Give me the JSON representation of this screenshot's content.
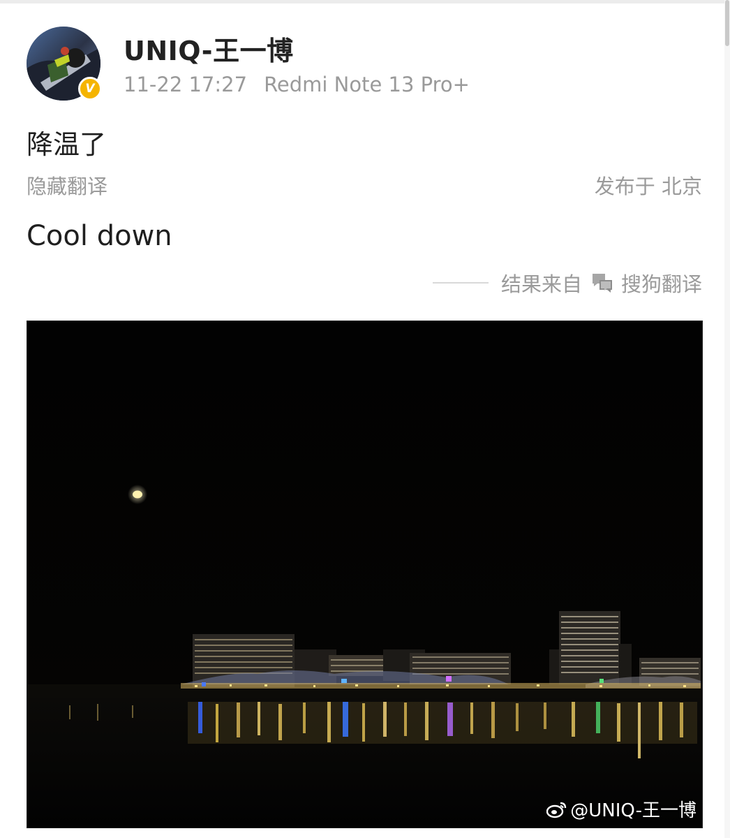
{
  "post": {
    "author": {
      "name": "UNIQ-王一博",
      "verified_badge": "V",
      "badge_color": "#f5b400"
    },
    "time": "11-22 17:27",
    "device": "Redmi Note 13 Pro+",
    "text": "降温了",
    "hide_translation_label": "隐藏翻译",
    "location": "发布于 北京",
    "translated_text": "Cool down",
    "translation_source": {
      "prefix": "结果来自",
      "icon": "chat-bubble-icon",
      "provider": "搜狗翻译"
    },
    "image": {
      "description_icon": "night-city-photo",
      "watermark": "@UNIQ-王一博",
      "watermark_icon": "weibo-icon"
    }
  },
  "colors": {
    "text_primary": "#1f1f1f",
    "text_secondary": "#9a9a9a",
    "photo_background": "#030303"
  }
}
